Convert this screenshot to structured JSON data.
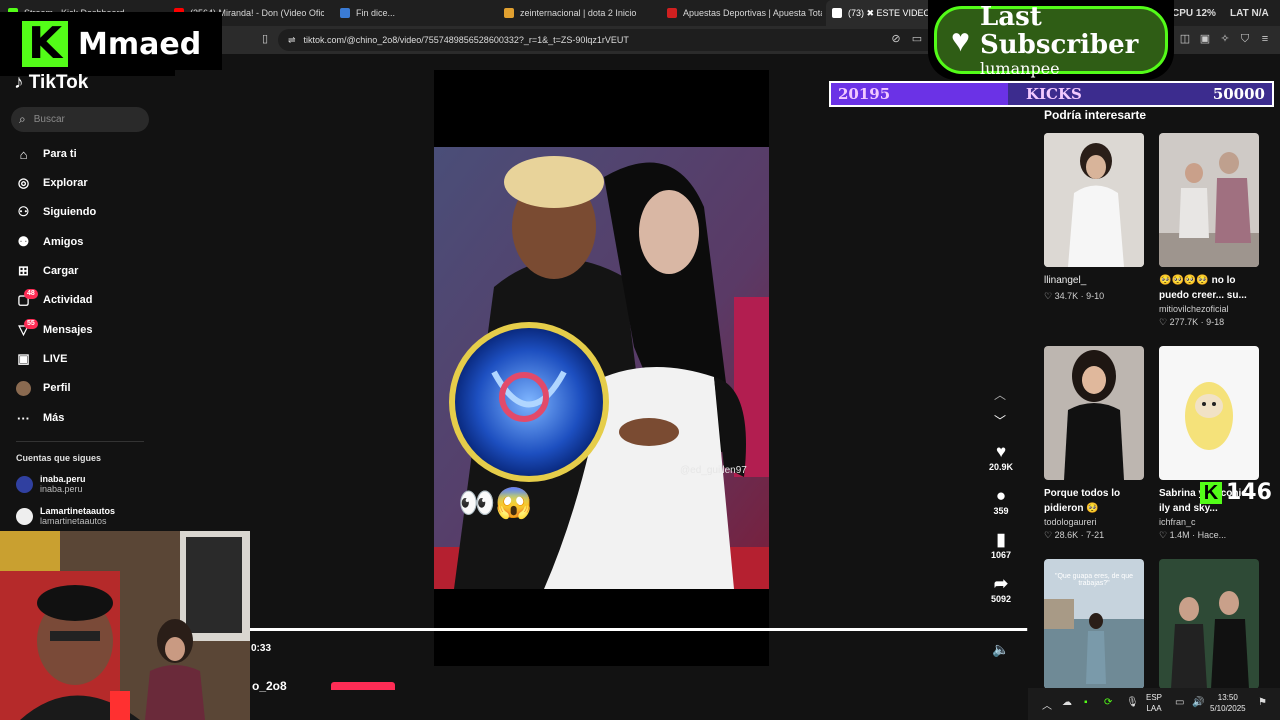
{
  "browser": {
    "tabs": [
      {
        "label": "Stream - Kick Dashboard",
        "color": "#53fc18"
      },
      {
        "label": "(2564) Miranda! - Don (Video Oficial)",
        "color": "#ff0000"
      },
      {
        "label": "Fin dice...",
        "color": "#3a7bd5"
      },
      {
        "label": "zeinternacional | dota 2 Inicio",
        "color": "#e0a030"
      },
      {
        "label": "Apuestas Deportivas | Apuesta Total",
        "color": "#d02020"
      },
      {
        "label": "(73) ✖ ESTE VIDEO NO ES",
        "color": "#ffffff"
      }
    ],
    "url": "tiktok.com/@chino_2o8/video/7557489856528600332?_r=1&_t=ZS-90lqz1rVEUT",
    "sys_cpu_label": "CPU",
    "sys_cpu_value": "12%",
    "sys_lat_label": "LAT",
    "sys_lat_value": "N/A"
  },
  "overlay": {
    "streamer_name": "Mmaed",
    "last_subscriber_title": "Last Subscriber",
    "last_subscriber_name": "lumanpee",
    "kicks_current": "20195",
    "kicks_label": "KICKS",
    "kicks_goal": "50000",
    "kicks_progress": 0.4039,
    "viewer_count": "146"
  },
  "tiktok": {
    "logo": "TikTok",
    "search_placeholder": "Buscar",
    "nav": [
      {
        "label": "Para ti",
        "icon": "home-icon"
      },
      {
        "label": "Explorar",
        "icon": "compass-icon"
      },
      {
        "label": "Siguiendo",
        "icon": "following-icon"
      },
      {
        "label": "Amigos",
        "icon": "friends-icon"
      },
      {
        "label": "Cargar",
        "icon": "upload-icon"
      },
      {
        "label": "Actividad",
        "icon": "activity-icon",
        "badge": "48"
      },
      {
        "label": "Mensajes",
        "icon": "messages-icon",
        "badge": "55"
      },
      {
        "label": "LIVE",
        "icon": "live-icon"
      },
      {
        "label": "Perfil",
        "icon": "profile-avatar"
      },
      {
        "label": "Más",
        "icon": "more-icon"
      }
    ],
    "following_title": "Cuentas que sigues",
    "following": [
      {
        "name": "inaba.peru",
        "handle": "inaba.peru"
      },
      {
        "name": "Lamartinetaautos",
        "handle": "lamartinetaautos"
      }
    ],
    "video": {
      "watermark": "@ed_guillen97",
      "emojis": "👀😱",
      "likes": "20.9K",
      "comments": "359",
      "saves": "1067",
      "shares": "5092",
      "time": "0:33",
      "progress": 0.999,
      "author": "o_2o8"
    },
    "recommendations_title": "Podría interesarte",
    "recommendations": [
      {
        "caption": "llinangel_",
        "user": "",
        "likes": "34.7K",
        "date": "9-10"
      },
      {
        "caption": "🥺🥺🥺🥺 no lo puedo creer... su...",
        "user": "mitiovilchezoficial",
        "likes": "277.7K",
        "date": "9-18"
      },
      {
        "caption": "Porque todos lo pidieron 🥺",
        "user": "todologaureri",
        "likes": "28.6K",
        "date": "7-21"
      },
      {
        "caption": "Sabrina y ... iconic ily and sky...",
        "user": "ichfran_c",
        "likes": "1.4M",
        "date": "Hace..."
      },
      {
        "caption": "\"Que guapa eres, de que trabajas?\"",
        "user": "",
        "likes": "",
        "date": ""
      },
      {
        "caption": "",
        "user": "",
        "likes": "",
        "date": ""
      }
    ]
  },
  "taskbar": {
    "lang1": "ESP",
    "lang2": "LAA",
    "time": "13:50",
    "date": "5/10/2025"
  },
  "colors": {
    "kick_green": "#53fc18",
    "tiktok_red": "#fe2c55",
    "goal_purple": "#6b32e6"
  }
}
